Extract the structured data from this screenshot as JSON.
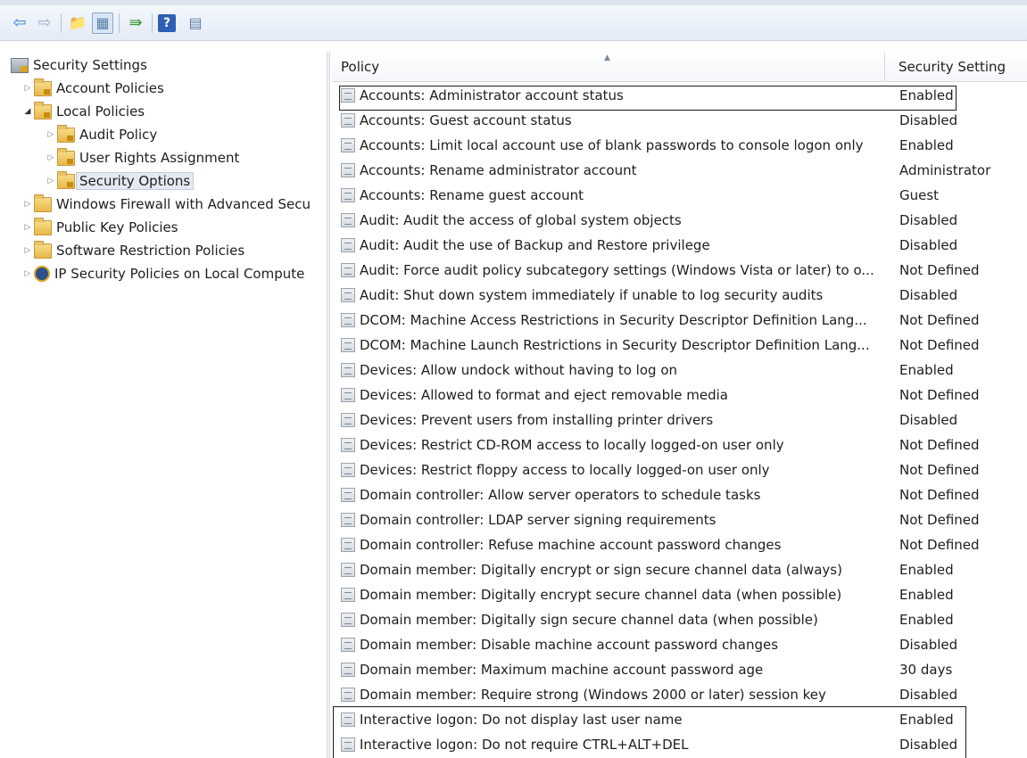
{
  "toolbar": {
    "buttons": [
      {
        "name": "back-arrow-icon",
        "glyph": "⇦"
      },
      {
        "name": "forward-arrow-icon",
        "glyph": "⇨"
      },
      {
        "name": "up-folder-icon",
        "glyph": "📁"
      },
      {
        "name": "show-hide-tree-icon",
        "glyph": "▦"
      },
      {
        "name": "export-list-icon",
        "glyph": "⇛"
      },
      {
        "name": "help-icon",
        "glyph": "?"
      },
      {
        "name": "properties-icon",
        "glyph": "▤"
      }
    ]
  },
  "tree": {
    "items": [
      {
        "label": "Security Settings",
        "level": 0,
        "expander": "",
        "icon": "settings-icon"
      },
      {
        "label": "Account Policies",
        "level": 1,
        "expander": "collapsed",
        "icon": "lock-folder-icon"
      },
      {
        "label": "Local Policies",
        "level": 1,
        "expander": "expanded",
        "icon": "lock-folder-icon"
      },
      {
        "label": "Audit Policy",
        "level": 2,
        "expander": "collapsed",
        "icon": "lock-folder-icon"
      },
      {
        "label": "User Rights Assignment",
        "level": 2,
        "expander": "collapsed",
        "icon": "lock-folder-icon"
      },
      {
        "label": "Security Options",
        "level": 2,
        "expander": "collapsed",
        "icon": "lock-folder-icon",
        "selected": true
      },
      {
        "label": "Windows Firewall with Advanced Secu",
        "level": 1,
        "expander": "collapsed",
        "icon": "folder-icon"
      },
      {
        "label": "Public Key Policies",
        "level": 1,
        "expander": "collapsed",
        "icon": "folder-icon"
      },
      {
        "label": "Software Restriction Policies",
        "level": 1,
        "expander": "collapsed",
        "icon": "folder-icon"
      },
      {
        "label": "IP Security Policies on Local Compute",
        "level": 1,
        "expander": "collapsed",
        "icon": "ipsec-icon"
      }
    ]
  },
  "list": {
    "columns": {
      "policy": "Policy",
      "setting": "Security Setting"
    },
    "rows": [
      {
        "policy": "Accounts: Administrator account status",
        "setting": "Enabled"
      },
      {
        "policy": "Accounts: Guest account status",
        "setting": "Disabled"
      },
      {
        "policy": "Accounts: Limit local account use of blank passwords to console logon only",
        "setting": "Enabled"
      },
      {
        "policy": "Accounts: Rename administrator account",
        "setting": "Administrator"
      },
      {
        "policy": "Accounts: Rename guest account",
        "setting": "Guest"
      },
      {
        "policy": "Audit: Audit the access of global system objects",
        "setting": "Disabled"
      },
      {
        "policy": "Audit: Audit the use of Backup and Restore privilege",
        "setting": "Disabled"
      },
      {
        "policy": "Audit: Force audit policy subcategory settings (Windows Vista or later) to o...",
        "setting": "Not Defined"
      },
      {
        "policy": "Audit: Shut down system immediately if unable to log security audits",
        "setting": "Disabled"
      },
      {
        "policy": "DCOM: Machine Access Restrictions in Security Descriptor Definition Lang...",
        "setting": "Not Defined"
      },
      {
        "policy": "DCOM: Machine Launch Restrictions in Security Descriptor Definition Lang...",
        "setting": "Not Defined"
      },
      {
        "policy": "Devices: Allow undock without having to log on",
        "setting": "Enabled"
      },
      {
        "policy": "Devices: Allowed to format and eject removable media",
        "setting": "Not Defined"
      },
      {
        "policy": "Devices: Prevent users from installing printer drivers",
        "setting": "Disabled"
      },
      {
        "policy": "Devices: Restrict CD-ROM access to locally logged-on user only",
        "setting": "Not Defined"
      },
      {
        "policy": "Devices: Restrict floppy access to locally logged-on user only",
        "setting": "Not Defined"
      },
      {
        "policy": "Domain controller: Allow server operators to schedule tasks",
        "setting": "Not Defined"
      },
      {
        "policy": "Domain controller: LDAP server signing requirements",
        "setting": "Not Defined"
      },
      {
        "policy": "Domain controller: Refuse machine account password changes",
        "setting": "Not Defined"
      },
      {
        "policy": "Domain member: Digitally encrypt or sign secure channel data (always)",
        "setting": "Enabled"
      },
      {
        "policy": "Domain member: Digitally encrypt secure channel data (when possible)",
        "setting": "Enabled"
      },
      {
        "policy": "Domain member: Digitally sign secure channel data (when possible)",
        "setting": "Enabled"
      },
      {
        "policy": "Domain member: Disable machine account password changes",
        "setting": "Disabled"
      },
      {
        "policy": "Domain member: Maximum machine account password age",
        "setting": "30 days"
      },
      {
        "policy": "Domain member: Require strong (Windows 2000 or later) session key",
        "setting": "Disabled"
      },
      {
        "policy": "Interactive logon: Do not display last user name",
        "setting": "Enabled"
      },
      {
        "policy": "Interactive logon: Do not require CTRL+ALT+DEL",
        "setting": "Disabled"
      }
    ]
  }
}
